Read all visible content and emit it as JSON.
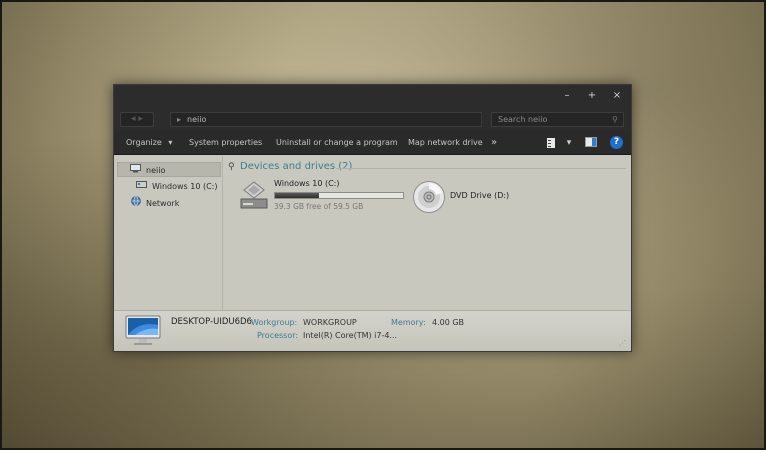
{
  "window": {
    "controls": {
      "minimize": "–",
      "maximize": "+",
      "close": "×"
    }
  },
  "address_bar": {
    "back_forward": "◂ ▸",
    "chevron": "▸",
    "path": "neiio",
    "search_placeholder": "Search neiio",
    "search_icon": "search-icon"
  },
  "toolbar": {
    "items": [
      {
        "label": "Organize",
        "dropdown": "▾"
      },
      {
        "label": "System properties"
      },
      {
        "label": "Uninstall or change a program"
      },
      {
        "label": "Map network drive"
      },
      {
        "label": "»"
      }
    ],
    "right_icons": [
      "view-icon",
      "view-dropdown-icon",
      "preview-pane-icon",
      "help-icon"
    ],
    "help_label": "?"
  },
  "nav_pane": {
    "items": [
      {
        "label": "neiio",
        "icon": "computer-icon",
        "selected": true
      },
      {
        "label": "Windows 10 (C:)",
        "icon": "drive-icon",
        "selected": false
      },
      {
        "label": "Network",
        "icon": "network-icon",
        "selected": false
      }
    ]
  },
  "content": {
    "group_icon": "collapse-icon",
    "group_title": "Devices and drives (2)",
    "drives": [
      {
        "name": "Windows 10 (C:)",
        "free_text": "39.3 GB free of 59.5 GB",
        "used_fraction": 0.34,
        "icon": "hard-drive-icon"
      },
      {
        "name": "DVD Drive (D:)",
        "icon": "dvd-icon"
      }
    ]
  },
  "details": {
    "computer_name": "DESKTOP-UIDU6D6",
    "workgroup_label": "Workgroup:",
    "workgroup_value": "WORKGROUP",
    "memory_label": "Memory:",
    "memory_value": "4.00 GB",
    "processor_label": "Processor:",
    "processor_value": "Intel(R) Core(TM) i7-4..."
  },
  "colors": {
    "accent": "#3b7f92",
    "titlebar": "#2c2c2c",
    "help_blue": "#1f6fd1",
    "pane_bg": "#c9c8bf"
  }
}
